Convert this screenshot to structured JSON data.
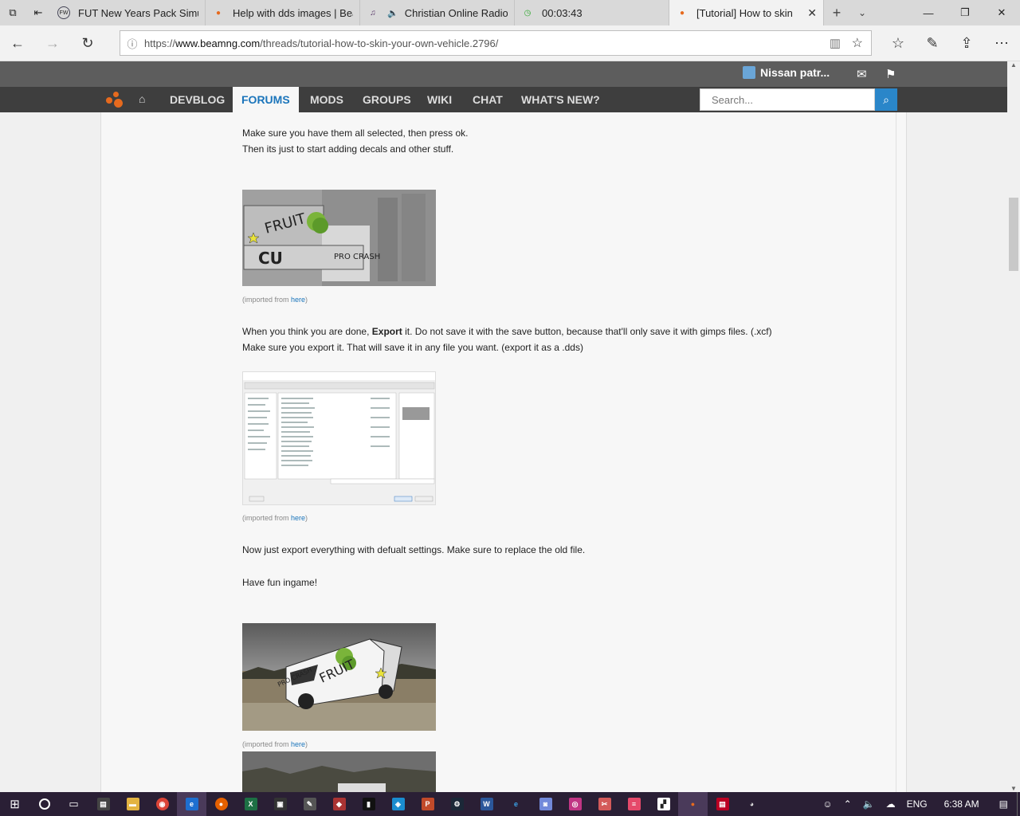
{
  "browser": {
    "tabs": [
      {
        "title": "FUT New Years Pack Simula",
        "icon": "futwiz-icon"
      },
      {
        "title": "Help with dds images | Bea",
        "icon": "beamng-icon"
      },
      {
        "title": "Christian Online Radio",
        "icon": "music-icon"
      },
      {
        "title": "00:03:43",
        "icon": "timer-icon"
      },
      {
        "title": "[Tutorial] How to skin",
        "icon": "beamng-icon",
        "active": true
      }
    ],
    "url_prefix": "https://",
    "url_domain": "www.beamng.com",
    "url_path": "/threads/tutorial-how-to-skin-your-own-vehicle.2796/"
  },
  "site": {
    "username": "Nissan patr...",
    "nav": [
      "DEVBLOG",
      "FORUMS",
      "MODS",
      "GROUPS",
      "WIKI",
      "CHAT",
      "WHAT'S NEW?"
    ],
    "active_nav": "FORUMS",
    "search_placeholder": "Search...",
    "accent": "#1b75bb"
  },
  "post": {
    "line1": "Make sure you have them all selected, then press ok.",
    "line2": "Then its just to start adding decals and other stuff.",
    "caption_prefix": "(imported from ",
    "caption_link": "here",
    "caption_suffix": ")",
    "export_pre": "When you think you are done, ",
    "export_bold": "Export",
    "export_post": " it. Do not save it with the save button, because that'll only save it with gimps files. (.xcf)",
    "export_line2": "Make sure you export it. That will save it in any file you want. (export it as a .dds)",
    "line_export_all": "Now just export everything with defualt settings. Make sure to replace the old file.",
    "line_fun": "Have fun ingame!",
    "image1_text": [
      "FRUIT",
      "CU",
      "PRO CRASH"
    ],
    "image3_text": [
      "PRO CRASH",
      "FRUIT"
    ]
  },
  "taskbar": {
    "lang": "ENG",
    "time": "6:38 AM"
  }
}
